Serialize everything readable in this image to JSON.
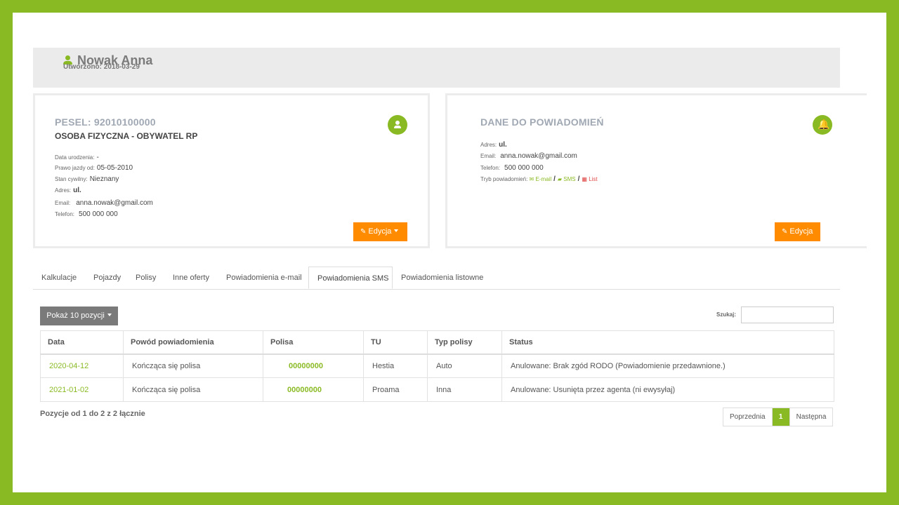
{
  "client": {
    "name": "Nowak Anna",
    "created": "Utworzono: 2018-03-29"
  },
  "card1": {
    "title": "PESEL: 92010100000",
    "subtitle": "OSOBA FIZYCZNA - OBYWATEL RP",
    "fields": [
      {
        "label": "Data urodzenia:",
        "value": "-"
      },
      {
        "label": "Prawo jazdy od:",
        "value": "05-05-2010"
      },
      {
        "label": "Stan cywilny:",
        "value": "Nieznany"
      },
      {
        "label": "Adres:",
        "value": "ul."
      },
      {
        "label": "Email:",
        "value": "anna.nowak@gmail.com"
      },
      {
        "label": "Telefon:",
        "value": "500 000 000"
      }
    ],
    "edit_label": "Edycja"
  },
  "card2": {
    "title": "DANE DO POWIADOMIEŃ",
    "fields": [
      {
        "label": "Adres:",
        "value": "ul."
      },
      {
        "label": "Email:",
        "value": "anna.nowak@gmail.com"
      },
      {
        "label": "Telefon:",
        "value": "500 000 000"
      }
    ],
    "mode_label": "Tryb powiadomień:",
    "modes": [
      "E-mail",
      "SMS",
      "List"
    ],
    "edit_label": "Edycja"
  },
  "tabs": [
    "Kalkulacje",
    "Pojazdy",
    "Polisy",
    "Inne oferty",
    "Powiadomienia e-mail",
    "Powiadomienia SMS",
    "Powiadomienia listowne"
  ],
  "active_tab": "Powiadomienia SMS",
  "table": {
    "length_label": "Pokaż 10 pozycji",
    "search_label": "Szukaj:",
    "search_value": "",
    "headers": [
      "Data",
      "Powód powiadomienia",
      "Polisa",
      "TU",
      "Typ polisy",
      "Status"
    ],
    "rows": [
      [
        "2020-04-12",
        "Kończąca się polisa",
        "00000000",
        "Hestia",
        "Auto",
        "Anulowane: Brak zgód RODO (Powiadomienie przedawnione.)"
      ],
      [
        "2021-01-02",
        "Kończąca się polisa",
        "00000000",
        "Proama",
        "Inna",
        "Anulowane: Usunięta przez agenta (ni ewysyłaj)"
      ]
    ],
    "info": "Pozycje od 1 do 2 z 2 łącznie"
  },
  "pagination": {
    "prev": "Poprzednia",
    "current": "1",
    "next": "Następna"
  },
  "colors": {
    "accent": "#8aba23",
    "edit": "#ff8c00",
    "list_mode": "#e04848"
  }
}
